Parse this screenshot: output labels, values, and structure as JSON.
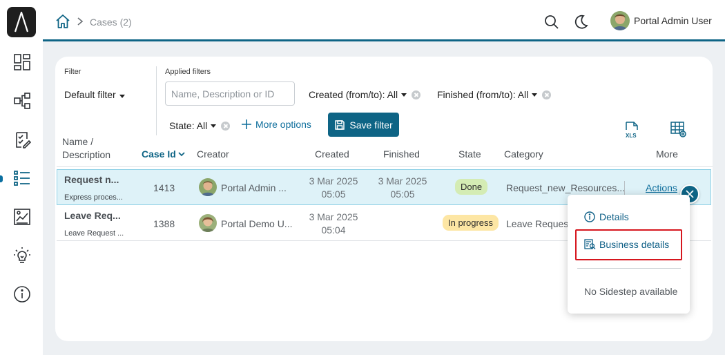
{
  "breadcrumb": {
    "current": "Cases (2)"
  },
  "header": {
    "user_name": "Portal Admin User"
  },
  "filters": {
    "filter_label": "Filter",
    "filter_value": "Default filter",
    "applied_label": "Applied filters",
    "search_placeholder": "Name, Description or ID",
    "created": "Created (from/to): All",
    "finished": "Finished (from/to): All",
    "state": "State: All",
    "more_options": "More options",
    "save_filter": "Save filter"
  },
  "table": {
    "headers": {
      "name_line1": "Name /",
      "name_line2": "Description",
      "case_id": "Case Id",
      "creator": "Creator",
      "created": "Created",
      "finished": "Finished",
      "state": "State",
      "category": "Category",
      "more": "More"
    },
    "rows": [
      {
        "name": "Request n...",
        "description": "Express proces...",
        "case_id": "1413",
        "creator": "Portal Admin ...",
        "created_date": "3 Mar 2025",
        "created_time": "05:05",
        "finished_date": "3 Mar 2025",
        "finished_time": "05:05",
        "state": "Done",
        "category": "Request_new_Resources...",
        "actions": "Actions"
      },
      {
        "name": "Leave Req...",
        "description": "Leave Request ...",
        "case_id": "1388",
        "creator": "Portal Demo U...",
        "created_date": "3 Mar 2025",
        "created_time": "05:04",
        "state": "In progress",
        "category": "Leave Request"
      }
    ]
  },
  "popup": {
    "details": "Details",
    "business_details": "Business details",
    "no_sidestep": "No Sidestep available"
  },
  "colors": {
    "accent": "#0e6485",
    "link": "#0e6e9c",
    "selected_row": "#def2f8",
    "done_badge": "#d4ecb4",
    "progress_badge": "#fde6a4",
    "highlight": "#d6161e"
  }
}
